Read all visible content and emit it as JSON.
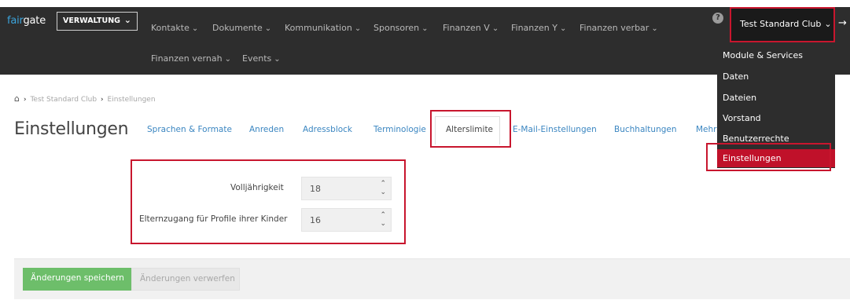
{
  "header": {
    "brand_accent": "fair",
    "brand_rest": "gate",
    "module": "VERWALTUNG",
    "nav_row1": [
      {
        "label": "Kontakte"
      },
      {
        "label": "Dokumente"
      },
      {
        "label": "Kommunikation"
      },
      {
        "label": "Sponsoren"
      },
      {
        "label": "Finanzen V"
      },
      {
        "label": "Finanzen Y"
      },
      {
        "label": "Finanzen verbar"
      }
    ],
    "nav_row2": [
      {
        "label": "Finanzen vernah"
      },
      {
        "label": "Events"
      }
    ],
    "help": "?",
    "club": "Test Standard Club",
    "chevron": "⌄",
    "logout_icon": "→]"
  },
  "club_menu": {
    "items": [
      {
        "label": "Module & Services"
      },
      {
        "label": "Daten"
      },
      {
        "label": "Dateien"
      },
      {
        "label": "Vorstand"
      },
      {
        "label": "Benutzerrechte"
      },
      {
        "label": "Einstellungen"
      }
    ]
  },
  "breadcrumb": {
    "home_icon": "home-icon",
    "crumb1": "Test Standard Club",
    "crumb2": "Einstellungen"
  },
  "page": {
    "title": "Einstellungen"
  },
  "tabs": [
    {
      "label": "Sprachen & Formate"
    },
    {
      "label": "Anreden"
    },
    {
      "label": "Adressblock"
    },
    {
      "label": "Terminologie"
    },
    {
      "label": "Alterslimite"
    },
    {
      "label": "E-Mail-Einstellungen"
    },
    {
      "label": "Buchhaltungen"
    },
    {
      "label": "Mehr"
    }
  ],
  "form": {
    "fields": [
      {
        "label": "Volljährigkeit",
        "value": "18"
      },
      {
        "label": "Elternzugang für Profile ihrer Kinder",
        "value": "16"
      }
    ]
  },
  "actions": {
    "save": "Änderungen speichern",
    "discard": "Änderungen verwerfen"
  },
  "colors": {
    "navbar": "#2d2d2d",
    "highlight": "#c8162e",
    "active_menu": "#c0112a",
    "link": "#3b86c1",
    "save": "#6dbe6a"
  }
}
